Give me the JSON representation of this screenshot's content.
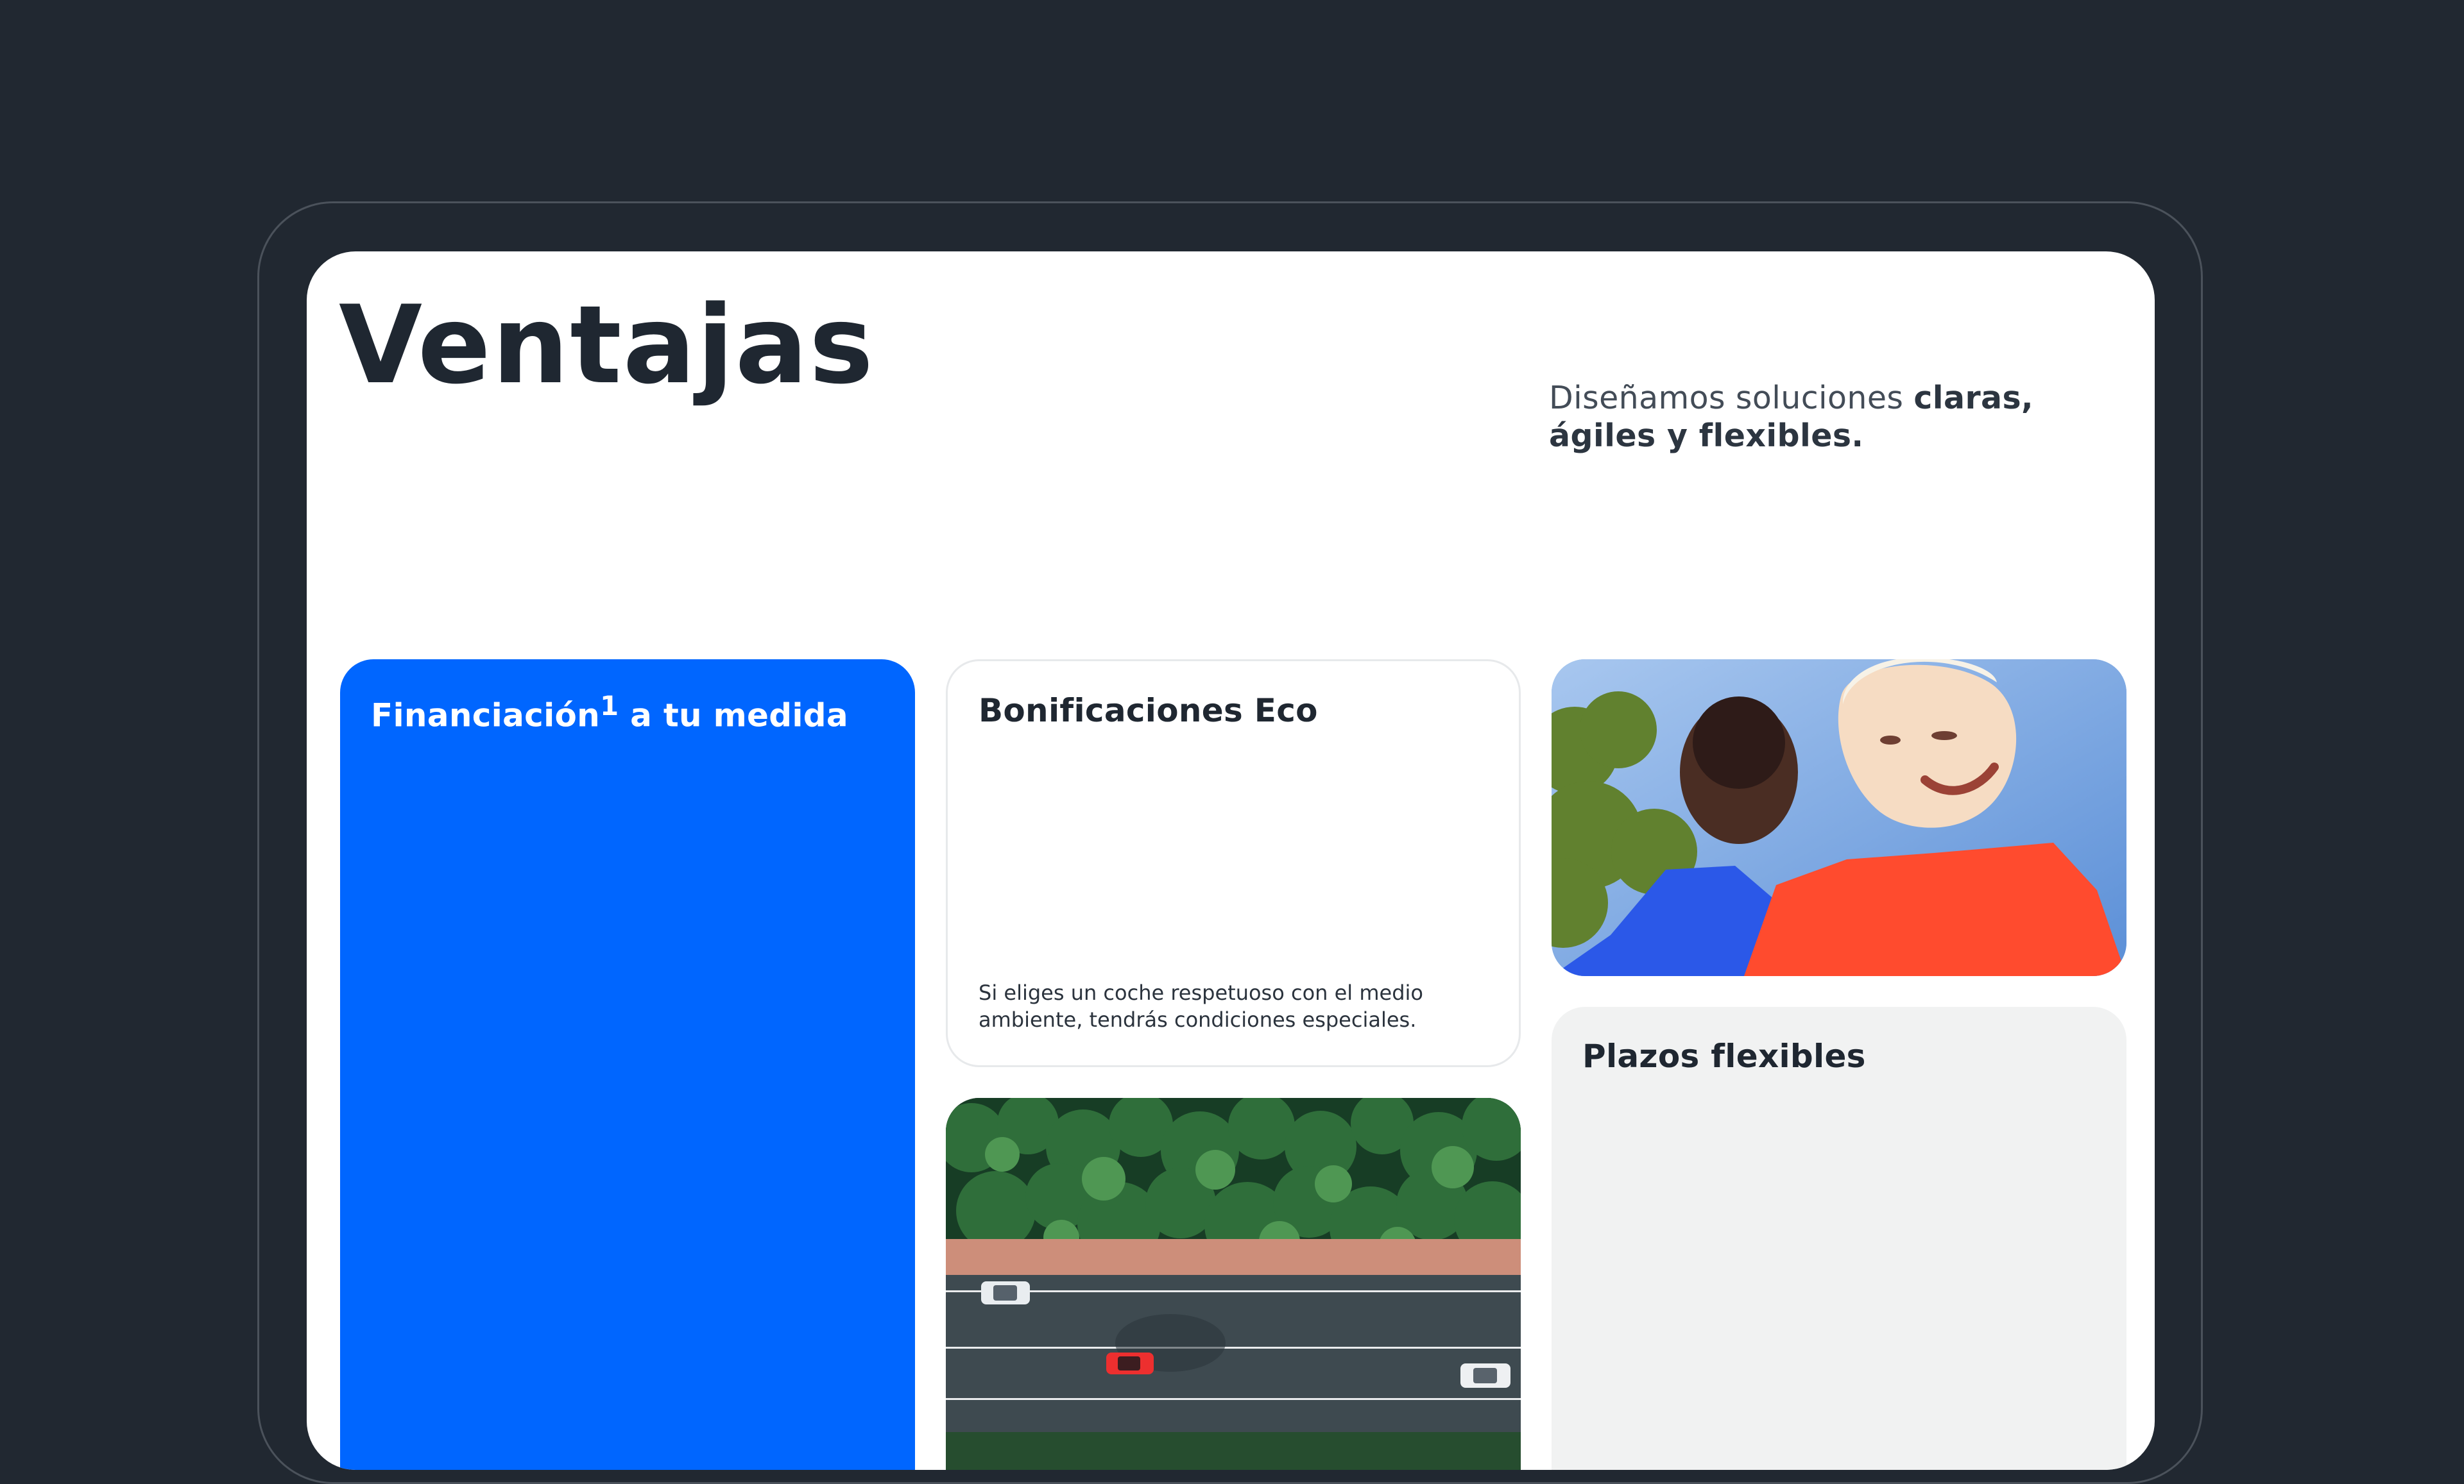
{
  "page": {
    "title": "Ventajas",
    "intro": {
      "text_before": "Diseñamos soluciones ",
      "text_bold": "claras, ágiles y flexibles."
    }
  },
  "cards": {
    "financing": {
      "title_before": "Financiación",
      "title_sup": "1",
      "title_after": " a tu medida"
    },
    "eco": {
      "title": "Bonificaciones Eco",
      "text": "Si eliges un coche respetuoso con el medio ambiente, tendrás condiciones especiales."
    },
    "flexible": {
      "title": "Plazos flexibles"
    }
  },
  "colors": {
    "background": "#212831",
    "accent_blue": "#0066ff",
    "card_grey": "#f1f2f2"
  }
}
